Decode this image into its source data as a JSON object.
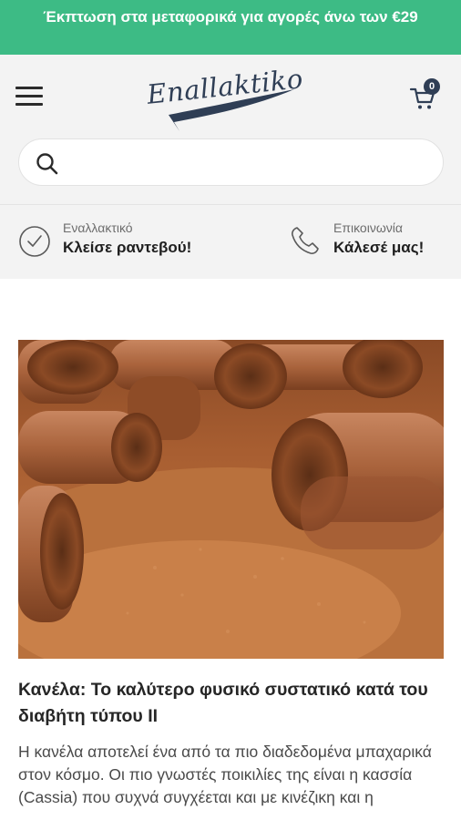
{
  "promo": {
    "text": "Έκπτωση στα μεταφορικά για αγορές άνω των €29"
  },
  "header": {
    "logo_text": "Enallaktiko",
    "cart_count": "0"
  },
  "search": {
    "placeholder": ""
  },
  "contact": {
    "appointment": {
      "small": "Εναλλακτικό",
      "big": "Κλείσε ραντεβού!"
    },
    "call": {
      "small": "Επικοινωνία",
      "big": "Κάλεσέ μας!"
    }
  },
  "article": {
    "title": "Κανέλα: Το καλύτερο φυσικό συστατικό κατά του διαβήτη τύπου ΙΙ",
    "excerpt": "Η κανέλα αποτελεί ένα από τα πιο διαδεδομένα μπαχαρικά στον κόσμο. Οι πιο γνωστές ποικιλίες της είναι η κασσία (Cassia) που συχνά συγχέεται και με κινέζικη και η"
  },
  "colors": {
    "promo_bg": "#3dbb85",
    "header_bg": "#f3f3f3",
    "brand_navy": "#2f3e55"
  }
}
